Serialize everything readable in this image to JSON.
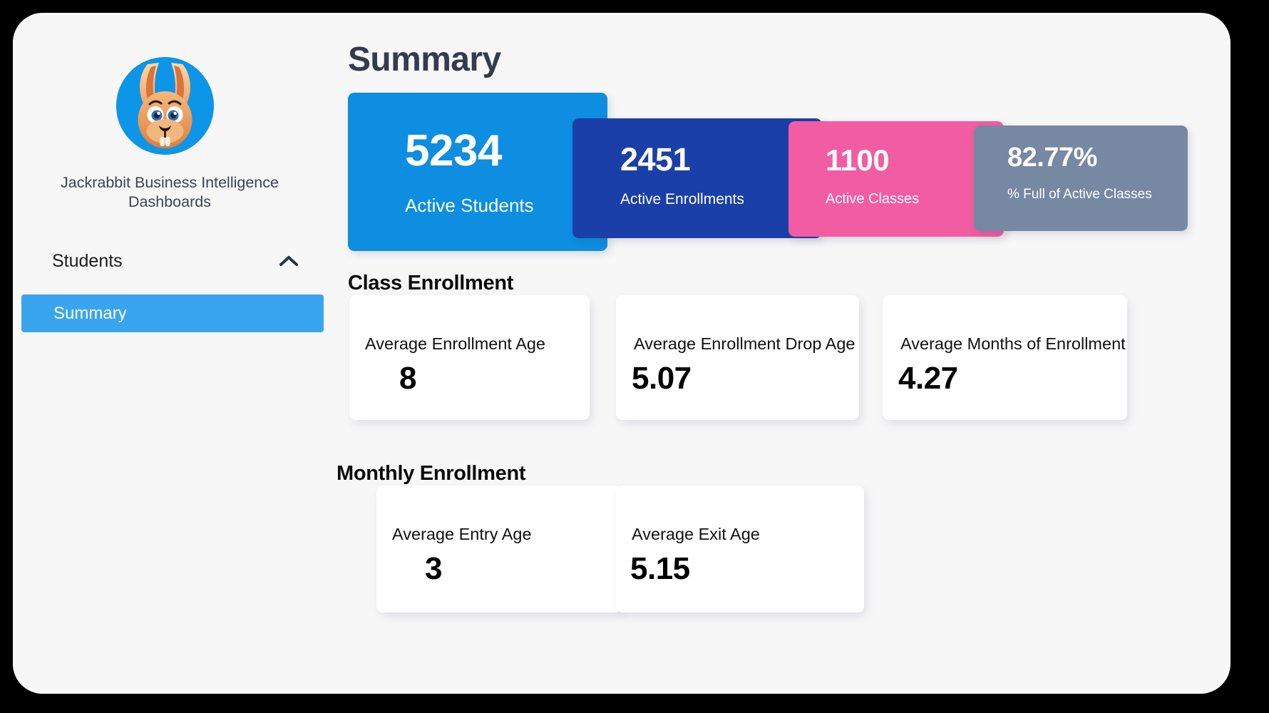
{
  "app": {
    "background_color": "#000000",
    "surface_color": "#f7f7f8"
  },
  "sidebar": {
    "brand_title": "Jackrabbit Business Intelligence Dashboards",
    "logo_icon": "jackrabbit-mascot-icon",
    "groups": [
      {
        "label": "Students",
        "expanded": true,
        "chevron_icon": "chevron-up-icon",
        "items": [
          {
            "label": "Summary",
            "active": true
          }
        ]
      }
    ],
    "active_item_color": "#3aa5ef"
  },
  "main": {
    "page_title": "Summary",
    "kpis": [
      {
        "value": "5234",
        "label": "Active Students",
        "color": "#0d8ee0"
      },
      {
        "value": "2451",
        "label": "Active Enrollments",
        "color": "#1b3fa8"
      },
      {
        "value": "1100",
        "label": "Active Classes",
        "color": "#f25ca2"
      },
      {
        "value": "82.77%",
        "label": "% Full of Active Classes",
        "color": "#7788a3"
      }
    ],
    "sections": [
      {
        "title": "Class Enrollment",
        "metrics": [
          {
            "label": "Average Enrollment Age",
            "value": "8"
          },
          {
            "label": "Average Enrollment Drop Age",
            "value": "5.07"
          },
          {
            "label": "Average Months of Enrollment",
            "value": "4.27"
          }
        ]
      },
      {
        "title": "Monthly Enrollment",
        "metrics": [
          {
            "label": "Average Entry Age",
            "value": "3"
          },
          {
            "label": "Average Exit Age",
            "value": "5.15"
          }
        ]
      }
    ]
  }
}
